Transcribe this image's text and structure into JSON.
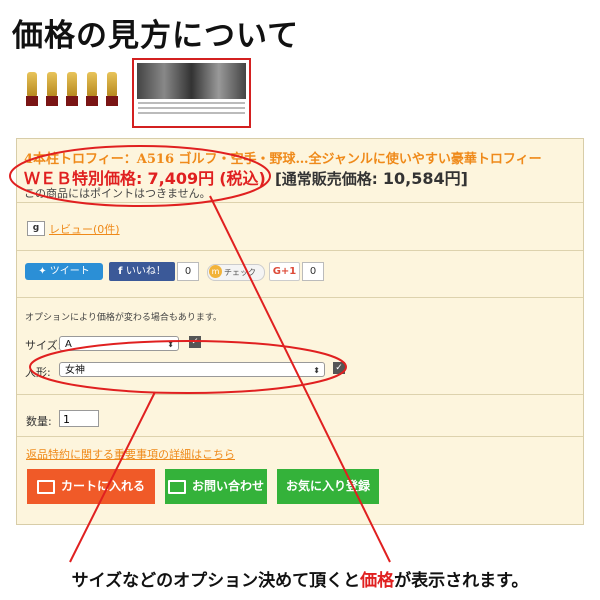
{
  "page": {
    "title": "価格の見方について"
  },
  "product": {
    "name": "4本柱トロフィー：A516 ゴルフ・空手・野球…全ジャンルに使いやすい豪華トロフィー",
    "web_price_label": "ＷＥＢ特別価格:",
    "web_price": "7,409円",
    "tax_note": "(税込)",
    "regular_price_label": "[通常販売価格:",
    "regular_price": "10,584円]",
    "points_note": "この商品にはポイントはつきません。"
  },
  "review": {
    "icon": "google-search-icon",
    "icon_text": "g",
    "link": "レビュー(0件)"
  },
  "social": {
    "tweet_label": "ツイート",
    "facebook_label": "いいね！",
    "facebook_count": "0",
    "check_label": "チェック",
    "check_icon": "mixi-icon",
    "gplus_label": "G+1",
    "gplus_count": "0"
  },
  "options": {
    "note": "オプションにより価格が変わる場合もあります。",
    "size_label": "サイズ:",
    "size_value": "A",
    "figure_label": "人形:",
    "figure_value": "女神"
  },
  "quantity": {
    "label": "数量:",
    "value": "1"
  },
  "returns": {
    "link": "返品特約に関する重要事項の詳細はこちら"
  },
  "actions": {
    "cart": "カートに入れる",
    "contact": "お問い合わせ",
    "favorite": "お気に入り登録"
  },
  "annotation": {
    "caption_pre": "サイズなどのオプション決めて頂くと",
    "caption_highlight": "価格",
    "caption_post": "が表示されます。",
    "highlight_color": "#e02020"
  }
}
